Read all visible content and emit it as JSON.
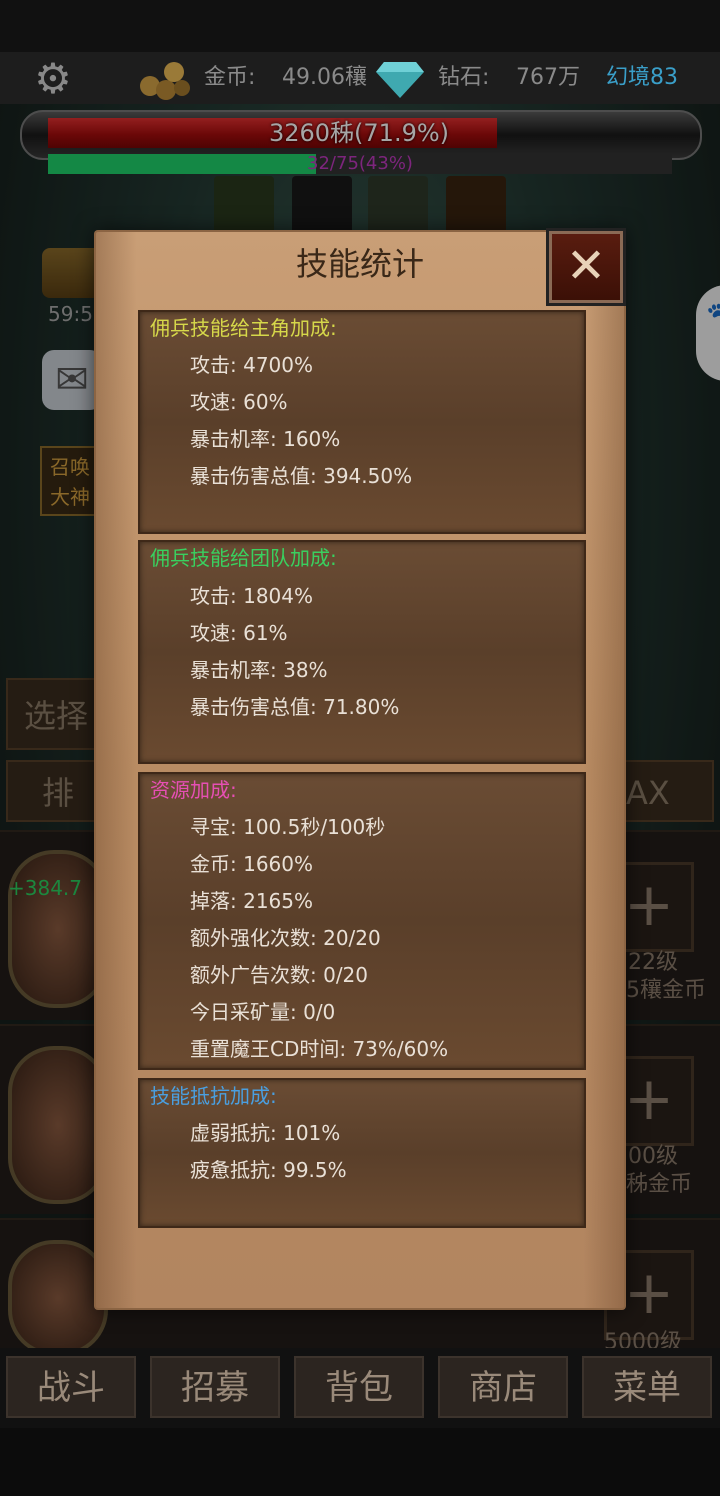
{
  "topbar": {
    "gold_label": "金币:",
    "gold_value": "49.06穰",
    "diamond_label": "钻石:",
    "diamond_value": "767万",
    "realm": "幻境83"
  },
  "boss": {
    "hp_text": "3260秭(71.9%)",
    "hp_fraction": 0.719,
    "progress_text": "32/75(43%)",
    "progress_fraction": 0.43
  },
  "side": {
    "timer": "59:5",
    "summon_label_1": "召唤",
    "summon_label_2": "大神"
  },
  "background_buttons": {
    "select": "选择",
    "sort": "排序",
    "max": "AX"
  },
  "hero_rows": [
    {
      "level": "22级",
      "cost": "5穰金币",
      "gain": "+384.7"
    },
    {
      "level": "00级",
      "cost": "秭金币"
    },
    {
      "level": "5000级"
    }
  ],
  "bottom_nav": [
    "战斗",
    "招募",
    "背包",
    "商店",
    "菜单"
  ],
  "dialog": {
    "title": "技能统计",
    "close": "✕",
    "sections": [
      {
        "header": "佣兵技能给主角加成:",
        "color": "#d6d84a",
        "rows": [
          "攻击:  4700%",
          "攻速:  60%",
          "暴击机率:  160%",
          "暴击伤害总值:  394.50%"
        ]
      },
      {
        "header": "佣兵技能给团队加成:",
        "color": "#39d05f",
        "rows": [
          "攻击:  1804%",
          "攻速:  61%",
          "暴击机率:  38%",
          "暴击伤害总值:  71.80%"
        ]
      },
      {
        "header": "资源加成:",
        "color": "#e64fb4",
        "rows": [
          "寻宝:  100.5秒/100秒",
          "金币:  1660%",
          "掉落:  2165%",
          "额外强化次数:  20/20",
          "额外广告次数:  0/20",
          "今日采矿量:  0/0",
          "重置魔王CD时间:  73%/60%"
        ]
      },
      {
        "header": "技能抵抗加成:",
        "color": "#4a9fe0",
        "rows": [
          "虚弱抵抗:  101%",
          "疲惫抵抗:  99.5%"
        ]
      }
    ]
  }
}
